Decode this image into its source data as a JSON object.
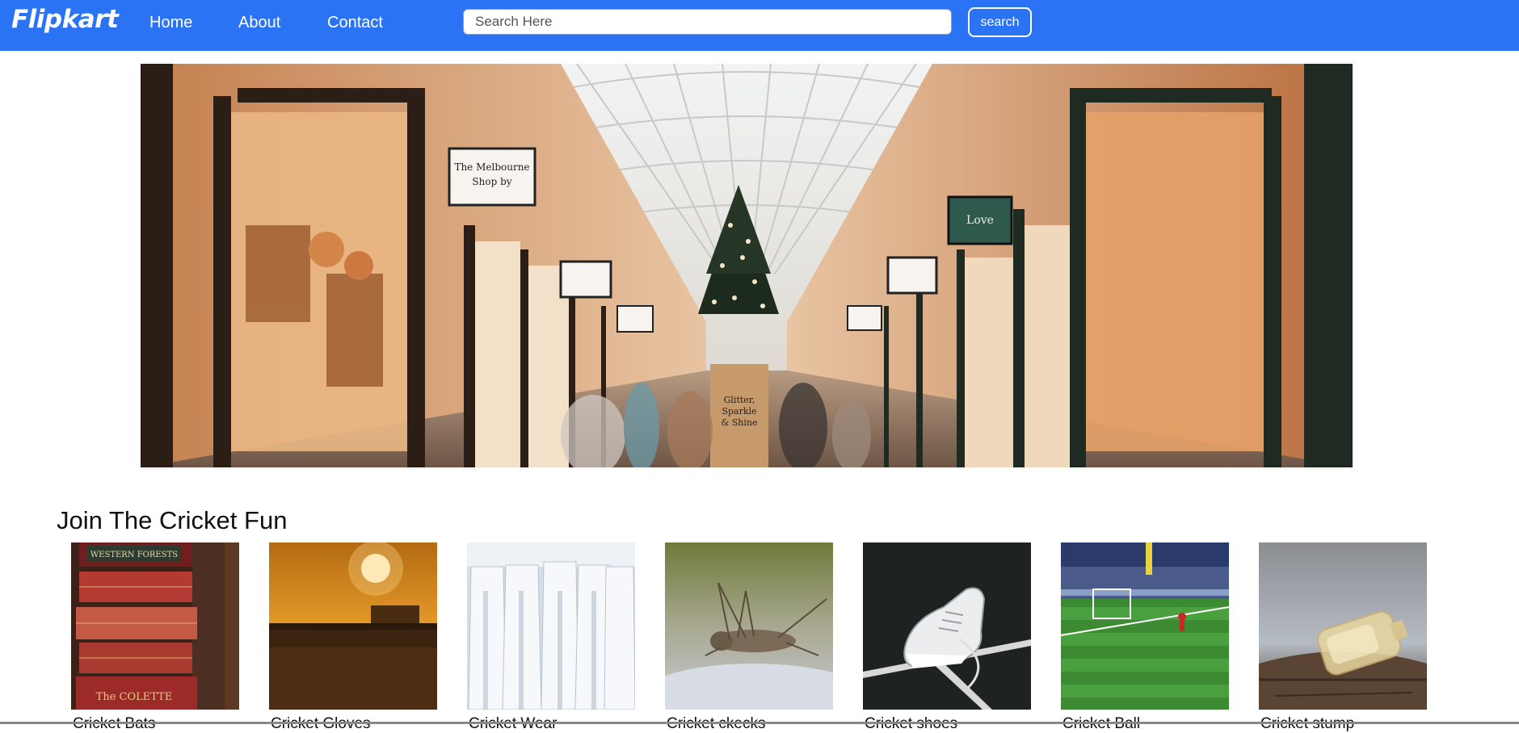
{
  "navbar": {
    "brand": "Flipkart",
    "links": [
      {
        "label": "Home"
      },
      {
        "label": "About"
      },
      {
        "label": "Contact"
      }
    ],
    "search": {
      "placeholder": "Search Here",
      "value": "",
      "button_label": "search"
    },
    "bg_color": "#2a73f5"
  },
  "hero": {
    "sign_1": "The Melbourne Shop by",
    "sign_2": "Glitter, Sparkle & Shine",
    "sign_3": "Love"
  },
  "section": {
    "title": "Join The Cricket Fun",
    "products": [
      {
        "label": "Cricket Bats",
        "icon": "books-image"
      },
      {
        "label": "Cricket Gloves",
        "icon": "sunset-field-image"
      },
      {
        "label": "Cricket Wear",
        "icon": "white-shirts-image"
      },
      {
        "label": "Cricket ckecks",
        "icon": "cricket-insect-image"
      },
      {
        "label": "Cricket shoes",
        "icon": "white-sneaker-image"
      },
      {
        "label": "Cricket Ball",
        "icon": "stadium-image"
      },
      {
        "label": "Cricket stump",
        "icon": "glass-bottle-image"
      }
    ]
  }
}
